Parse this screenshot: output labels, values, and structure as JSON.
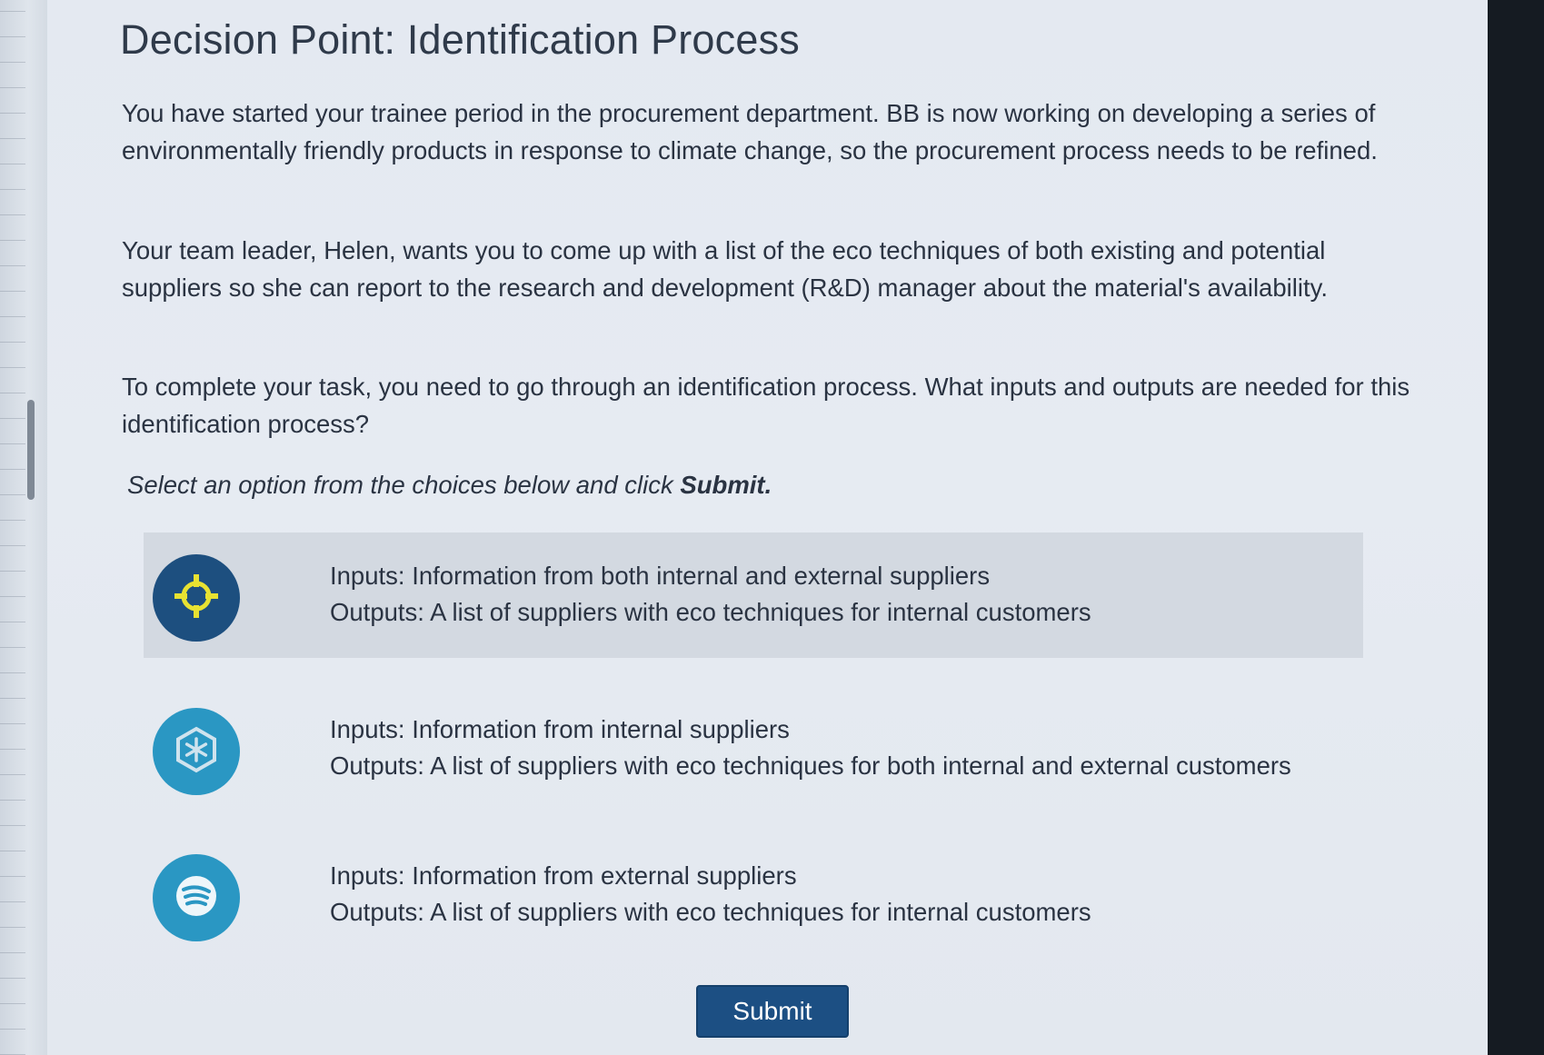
{
  "page": {
    "title": "Decision Point: Identification Process",
    "paragraphs": [
      "You have started your trainee period in the procurement department. BB is now working on developing a series of environmentally friendly products in response to climate change, so the procurement process needs to be refined.",
      "Your team leader, Helen, wants you to come up with a list of the eco techniques of both existing and potential suppliers so she can report to the research and development (R&D) manager about the material's availability.",
      "To complete your task, you need to go through an identification process. What inputs and outputs are needed for this identification process?"
    ],
    "instruction_prefix": "Select an option from the choices below and click ",
    "instruction_bold": "Submit.",
    "submit_label": "Submit"
  },
  "options": [
    {
      "inputs": "Inputs: Information from both internal and external suppliers",
      "outputs": "Outputs: A list of suppliers with eco techniques for internal customers",
      "icon": "crosshair-icon",
      "selected": true
    },
    {
      "inputs": "Inputs: Information from internal suppliers",
      "outputs": "Outputs: A list of suppliers with eco techniques for both internal and external customers",
      "icon": "snowflake-icon",
      "selected": false
    },
    {
      "inputs": "Inputs: Information from external suppliers",
      "outputs": "Outputs: A list of suppliers with eco techniques for internal customers",
      "icon": "signal-waves-icon",
      "selected": false
    }
  ],
  "colors": {
    "selected_icon_bg": "#1d4f7f",
    "icon_bg": "#2a97c3",
    "crosshair_yellow": "#e8e232",
    "submit_bg": "#1c4f83",
    "selected_row_bg": "#d3d9e1"
  }
}
